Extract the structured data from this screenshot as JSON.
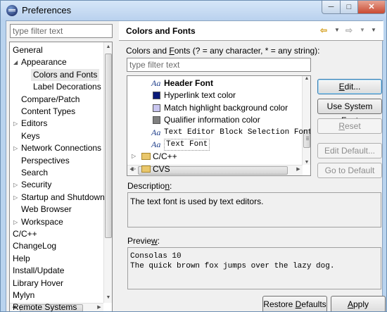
{
  "window": {
    "title": "Preferences",
    "minimize_glyph": "─",
    "maximize_glyph": "□",
    "close_glyph": "✕"
  },
  "left": {
    "filter_placeholder": "type filter text",
    "tree": [
      {
        "label": "General",
        "level": 0,
        "twisty": "none"
      },
      {
        "label": "Appearance",
        "level": 1,
        "twisty": "expanded"
      },
      {
        "label": "Colors and Fonts",
        "level": 2,
        "twisty": "none",
        "selected": true
      },
      {
        "label": "Label Decorations",
        "level": 2,
        "twisty": "none"
      },
      {
        "label": "Compare/Patch",
        "level": 1,
        "twisty": "none"
      },
      {
        "label": "Content Types",
        "level": 1,
        "twisty": "none"
      },
      {
        "label": "Editors",
        "level": 1,
        "twisty": "collapsed"
      },
      {
        "label": "Keys",
        "level": 1,
        "twisty": "none"
      },
      {
        "label": "Network Connections",
        "level": 1,
        "twisty": "collapsed"
      },
      {
        "label": "Perspectives",
        "level": 1,
        "twisty": "none"
      },
      {
        "label": "Search",
        "level": 1,
        "twisty": "none"
      },
      {
        "label": "Security",
        "level": 1,
        "twisty": "collapsed"
      },
      {
        "label": "Startup and Shutdown",
        "level": 1,
        "twisty": "collapsed"
      },
      {
        "label": "Web Browser",
        "level": 1,
        "twisty": "none"
      },
      {
        "label": "Workspace",
        "level": 1,
        "twisty": "collapsed"
      },
      {
        "label": "C/C++",
        "level": 0,
        "twisty": "none"
      },
      {
        "label": "ChangeLog",
        "level": 0,
        "twisty": "none"
      },
      {
        "label": "Help",
        "level": 0,
        "twisty": "none"
      },
      {
        "label": "Install/Update",
        "level": 0,
        "twisty": "none"
      },
      {
        "label": "Library Hover",
        "level": 0,
        "twisty": "none"
      },
      {
        "label": "Mylyn",
        "level": 0,
        "twisty": "none"
      },
      {
        "label": "Remote Systems",
        "level": 0,
        "twisty": "none"
      }
    ]
  },
  "page": {
    "title": "Colors and Fonts",
    "nav": {
      "back": "⇦",
      "dropdown": "▼",
      "forward": "⇨",
      "menu": "▼"
    },
    "filter_label_pre": "Colors and ",
    "filter_label_mnemonic": "F",
    "filter_label_post": "onts (? = any character, * = any string):",
    "filter_placeholder": "type filter text",
    "font_items": [
      {
        "label": "Header Font",
        "kind": "font",
        "bold": true
      },
      {
        "label": "Hyperlink text color",
        "kind": "color",
        "color": "#0a1a78"
      },
      {
        "label": "Match highlight background color",
        "kind": "color",
        "color": "#c9c6f0"
      },
      {
        "label": "Qualifier information color",
        "kind": "color",
        "color": "#808080"
      },
      {
        "label": "Text Editor Block Selection Font",
        "kind": "font",
        "mono": true
      },
      {
        "label": "Text Font",
        "kind": "font",
        "mono": true,
        "selected": true
      },
      {
        "label": "C/C++",
        "kind": "folder"
      },
      {
        "label": "CVS",
        "kind": "folder"
      }
    ],
    "aa_glyph": "Aa",
    "buttons": {
      "edit_pre": "",
      "edit_mn": "E",
      "edit_post": "dit...",
      "use_system_font": "Use System Font",
      "reset_pre": "",
      "reset_mn": "R",
      "reset_post": "eset",
      "edit_default": "Edit Default...",
      "go_to_default": "Go to Default"
    },
    "description_label_pre": "Descriptio",
    "description_label_mn": "n",
    "description_label_post": ":",
    "description_text": "The text font is used by text editors.",
    "preview_label_pre": "Previe",
    "preview_label_mn": "w",
    "preview_label_post": ":",
    "preview_line1": "Consolas 10",
    "preview_line2": "The quick brown fox jumps over the lazy dog.",
    "restore_defaults_pre": "Restore ",
    "restore_defaults_mn": "D",
    "restore_defaults_post": "efaults",
    "apply_pre": "",
    "apply_mn": "A",
    "apply_post": "pply"
  }
}
